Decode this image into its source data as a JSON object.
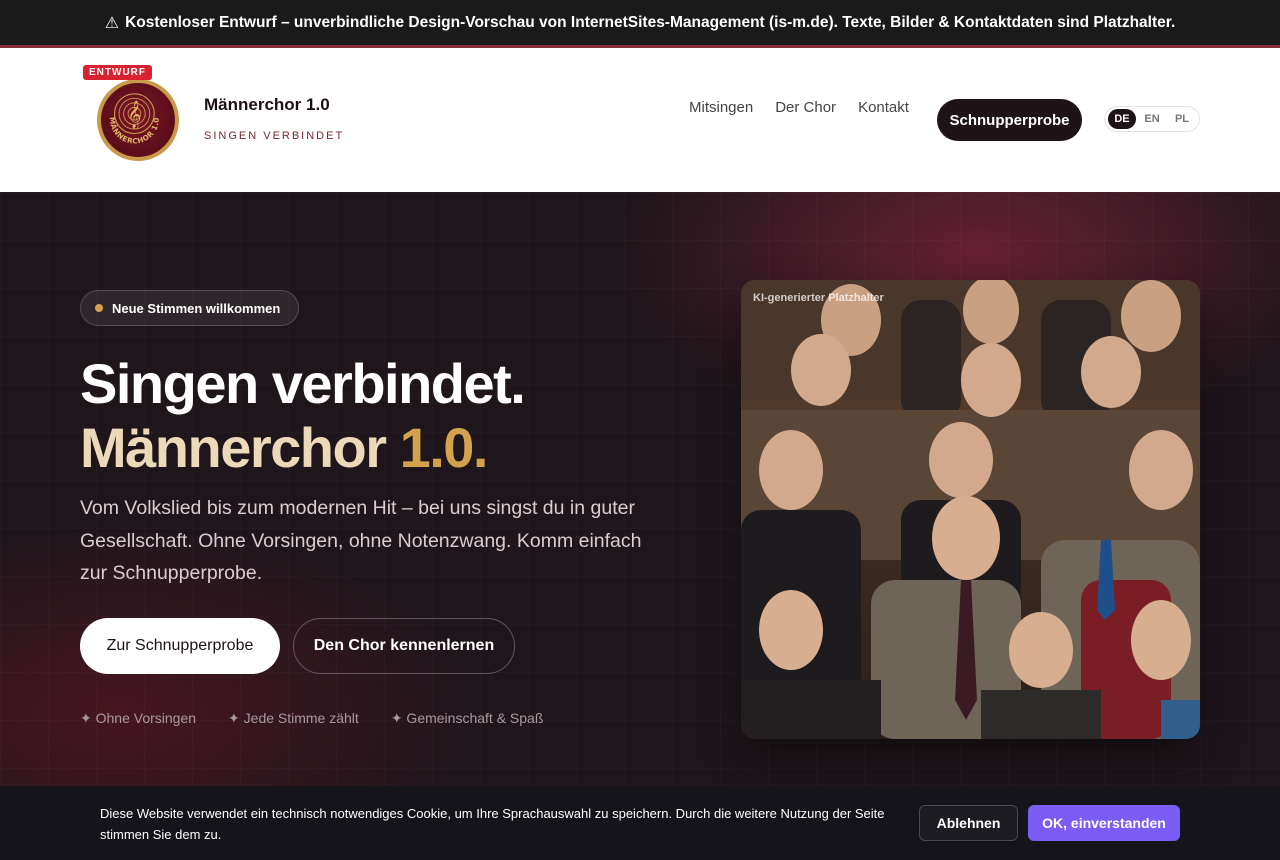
{
  "notice": {
    "icon": "warning-icon",
    "icon_glyph": "⚠",
    "text": "Kostenloser Entwurf – unverbindliche Design-Vorschau von InternetSites-Management (is-m.de). Texte, Bilder & Kontaktdaten sind Platzhalter."
  },
  "header": {
    "draft_badge": "ENTWURF",
    "logo_text": "MÄNNERCHOR 1.0",
    "brand_name": "Männerchor 1.0",
    "tagline": "SINGEN VERBINDET",
    "nav": [
      {
        "label": "Mitsingen"
      },
      {
        "label": "Der Chor"
      },
      {
        "label": "Kontakt"
      }
    ],
    "cta": "Schnupperprobe",
    "languages": [
      {
        "code": "DE",
        "active": true
      },
      {
        "code": "EN",
        "active": false
      },
      {
        "code": "PL",
        "active": false
      }
    ]
  },
  "hero": {
    "pill": "Neue Stimmen willkommen",
    "headline_line1": "Singen verbindet.",
    "headline_line2_a": "Männerchor ",
    "headline_line2_b": "1.0.",
    "lead": "Vom Volkslied bis zum modernen Hit – bei uns singst du in guter Gesellschaft. Ohne Vorsingen, ohne Notenzwang. Komm einfach zur Schnupperprobe.",
    "primary_button": "Zur Schnupperprobe",
    "secondary_button": "Den Chor kennenlernen",
    "features": [
      "✦ Ohne Vorsingen",
      "✦ Jede Stimme zählt",
      "✦ Gemeinschaft & Spaß"
    ],
    "photo_caption": "KI-generierter Platzhalter"
  },
  "cookie": {
    "text": "Diese Website verwendet ein technisch notwendiges Cookie, um Ihre Sprachauswahl zu speichern. Durch die weitere Nutzung der Seite stimmen Sie dem zu.",
    "decline": "Ablehnen",
    "accept": "OK, einverstanden"
  },
  "colors": {
    "accent_gold": "#d4a24c",
    "brand_dark": "#1e1417",
    "brand_red": "#7a1526",
    "cookie_accept": "#7b5cf5"
  }
}
